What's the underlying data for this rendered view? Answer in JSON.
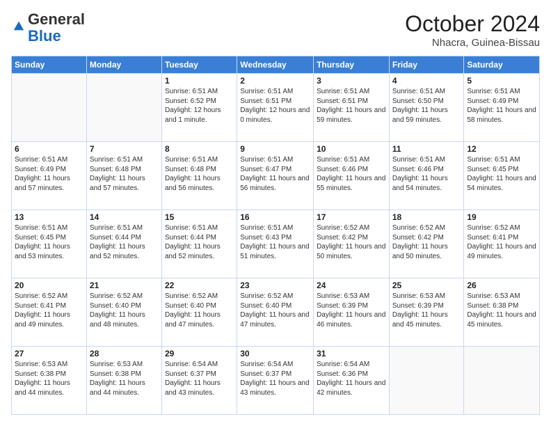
{
  "header": {
    "logo": {
      "line1": "General",
      "line2": "Blue"
    },
    "month": "October 2024",
    "location": "Nhacra, Guinea-Bissau"
  },
  "days_of_week": [
    "Sunday",
    "Monday",
    "Tuesday",
    "Wednesday",
    "Thursday",
    "Friday",
    "Saturday"
  ],
  "weeks": [
    [
      {
        "day": "",
        "info": ""
      },
      {
        "day": "",
        "info": ""
      },
      {
        "day": "1",
        "info": "Sunrise: 6:51 AM\nSunset: 6:52 PM\nDaylight: 12 hours and 1 minute."
      },
      {
        "day": "2",
        "info": "Sunrise: 6:51 AM\nSunset: 6:51 PM\nDaylight: 12 hours and 0 minutes."
      },
      {
        "day": "3",
        "info": "Sunrise: 6:51 AM\nSunset: 6:51 PM\nDaylight: 11 hours and 59 minutes."
      },
      {
        "day": "4",
        "info": "Sunrise: 6:51 AM\nSunset: 6:50 PM\nDaylight: 11 hours and 59 minutes."
      },
      {
        "day": "5",
        "info": "Sunrise: 6:51 AM\nSunset: 6:49 PM\nDaylight: 11 hours and 58 minutes."
      }
    ],
    [
      {
        "day": "6",
        "info": "Sunrise: 6:51 AM\nSunset: 6:49 PM\nDaylight: 11 hours and 57 minutes."
      },
      {
        "day": "7",
        "info": "Sunrise: 6:51 AM\nSunset: 6:48 PM\nDaylight: 11 hours and 57 minutes."
      },
      {
        "day": "8",
        "info": "Sunrise: 6:51 AM\nSunset: 6:48 PM\nDaylight: 11 hours and 56 minutes."
      },
      {
        "day": "9",
        "info": "Sunrise: 6:51 AM\nSunset: 6:47 PM\nDaylight: 11 hours and 56 minutes."
      },
      {
        "day": "10",
        "info": "Sunrise: 6:51 AM\nSunset: 6:46 PM\nDaylight: 11 hours and 55 minutes."
      },
      {
        "day": "11",
        "info": "Sunrise: 6:51 AM\nSunset: 6:46 PM\nDaylight: 11 hours and 54 minutes."
      },
      {
        "day": "12",
        "info": "Sunrise: 6:51 AM\nSunset: 6:45 PM\nDaylight: 11 hours and 54 minutes."
      }
    ],
    [
      {
        "day": "13",
        "info": "Sunrise: 6:51 AM\nSunset: 6:45 PM\nDaylight: 11 hours and 53 minutes."
      },
      {
        "day": "14",
        "info": "Sunrise: 6:51 AM\nSunset: 6:44 PM\nDaylight: 11 hours and 52 minutes."
      },
      {
        "day": "15",
        "info": "Sunrise: 6:51 AM\nSunset: 6:44 PM\nDaylight: 11 hours and 52 minutes."
      },
      {
        "day": "16",
        "info": "Sunrise: 6:51 AM\nSunset: 6:43 PM\nDaylight: 11 hours and 51 minutes."
      },
      {
        "day": "17",
        "info": "Sunrise: 6:52 AM\nSunset: 6:42 PM\nDaylight: 11 hours and 50 minutes."
      },
      {
        "day": "18",
        "info": "Sunrise: 6:52 AM\nSunset: 6:42 PM\nDaylight: 11 hours and 50 minutes."
      },
      {
        "day": "19",
        "info": "Sunrise: 6:52 AM\nSunset: 6:41 PM\nDaylight: 11 hours and 49 minutes."
      }
    ],
    [
      {
        "day": "20",
        "info": "Sunrise: 6:52 AM\nSunset: 6:41 PM\nDaylight: 11 hours and 49 minutes."
      },
      {
        "day": "21",
        "info": "Sunrise: 6:52 AM\nSunset: 6:40 PM\nDaylight: 11 hours and 48 minutes."
      },
      {
        "day": "22",
        "info": "Sunrise: 6:52 AM\nSunset: 6:40 PM\nDaylight: 11 hours and 47 minutes."
      },
      {
        "day": "23",
        "info": "Sunrise: 6:52 AM\nSunset: 6:40 PM\nDaylight: 11 hours and 47 minutes."
      },
      {
        "day": "24",
        "info": "Sunrise: 6:53 AM\nSunset: 6:39 PM\nDaylight: 11 hours and 46 minutes."
      },
      {
        "day": "25",
        "info": "Sunrise: 6:53 AM\nSunset: 6:39 PM\nDaylight: 11 hours and 45 minutes."
      },
      {
        "day": "26",
        "info": "Sunrise: 6:53 AM\nSunset: 6:38 PM\nDaylight: 11 hours and 45 minutes."
      }
    ],
    [
      {
        "day": "27",
        "info": "Sunrise: 6:53 AM\nSunset: 6:38 PM\nDaylight: 11 hours and 44 minutes."
      },
      {
        "day": "28",
        "info": "Sunrise: 6:53 AM\nSunset: 6:38 PM\nDaylight: 11 hours and 44 minutes."
      },
      {
        "day": "29",
        "info": "Sunrise: 6:54 AM\nSunset: 6:37 PM\nDaylight: 11 hours and 43 minutes."
      },
      {
        "day": "30",
        "info": "Sunrise: 6:54 AM\nSunset: 6:37 PM\nDaylight: 11 hours and 43 minutes."
      },
      {
        "day": "31",
        "info": "Sunrise: 6:54 AM\nSunset: 6:36 PM\nDaylight: 11 hours and 42 minutes."
      },
      {
        "day": "",
        "info": ""
      },
      {
        "day": "",
        "info": ""
      }
    ]
  ]
}
